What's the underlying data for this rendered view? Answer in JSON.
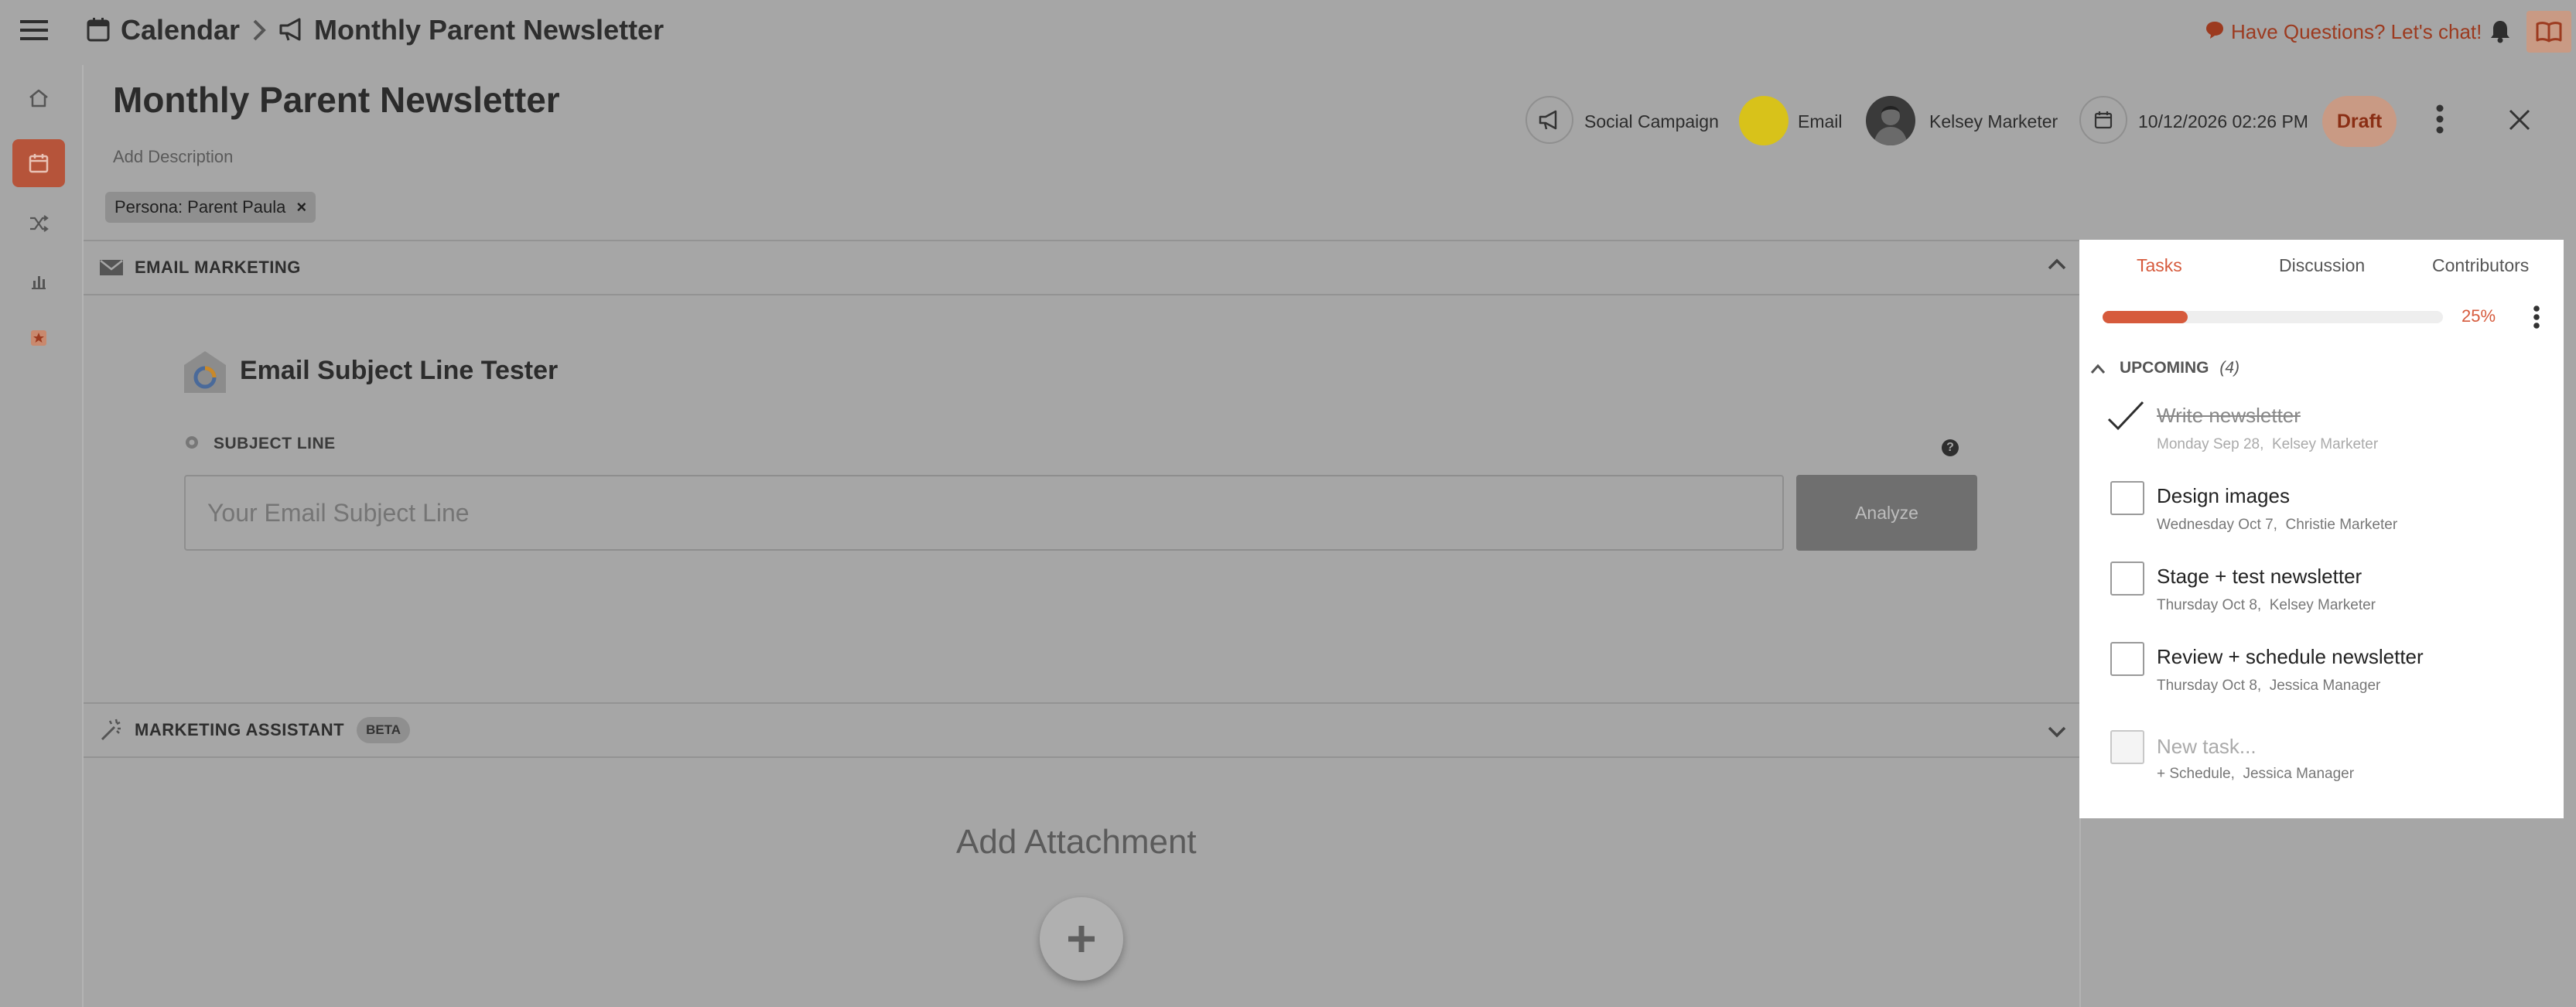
{
  "breadcrumb": {
    "calendar_label": "Calendar",
    "page_label": "Monthly Parent Newsletter"
  },
  "topbar": {
    "chat_label": "Have Questions? Let's chat!"
  },
  "item": {
    "title": "Monthly Parent Newsletter",
    "description_placeholder": "Add Description",
    "tag_label": "Persona: Parent Paula",
    "tag_remove": "×",
    "campaign_label": "Social Campaign",
    "channel_label": "Email",
    "channel_color": "#d8c21a",
    "owner_label": "Kelsey Marketer",
    "date_label": "10/12/2026 02:26 PM",
    "status_label": "Draft"
  },
  "email_section": {
    "header": "EMAIL MARKETING",
    "tool_title": "Email Subject Line Tester",
    "field_label": "SUBJECT LINE",
    "help_glyph": "?",
    "input_placeholder": "Your Email Subject Line",
    "analyze_label": "Analyze"
  },
  "assistant_section": {
    "header": "MARKETING ASSISTANT",
    "badge": "BETA"
  },
  "attachment": {
    "label": "Add Attachment"
  },
  "tasks_panel": {
    "tabs": [
      "Tasks",
      "Discussion",
      "Contributors"
    ],
    "active_tab": "Tasks",
    "progress_label": "25%",
    "progress_fraction": 0.25,
    "accent_color": "#d65a3c",
    "group_label": "UPCOMING",
    "group_count": "(4)",
    "tasks": [
      {
        "title": "Write newsletter",
        "date": "Monday Sep 28,",
        "assignee": "Kelsey Marketer",
        "done": true
      },
      {
        "title": "Design images",
        "date": "Wednesday Oct 7,",
        "assignee": "Christie Marketer",
        "done": false
      },
      {
        "title": "Stage + test newsletter",
        "date": "Thursday Oct 8,",
        "assignee": "Kelsey Marketer",
        "done": false
      },
      {
        "title": "Review + schedule newsletter",
        "date": "Thursday Oct 8,",
        "assignee": "Jessica Manager",
        "done": false
      }
    ],
    "new_task": {
      "placeholder": "New task...",
      "schedule": "+ Schedule,",
      "assignee": "Jessica Manager"
    }
  }
}
